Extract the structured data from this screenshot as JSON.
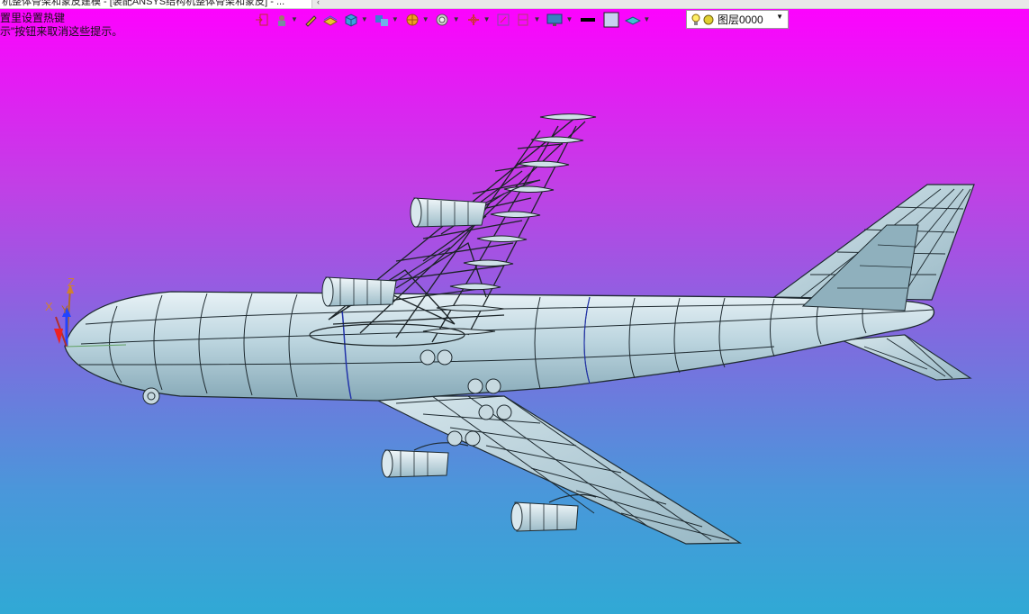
{
  "window": {
    "tab_title": "机整体骨架和蒙皮建模 - [装配ANSYS结构机整体骨架和蒙皮] - ...",
    "tab_scroll": "‹"
  },
  "hint": {
    "line1": "置里设置热键",
    "line2": "示\"按钮来取消这些提示。"
  },
  "toolbar": {
    "items": [
      {
        "name": "insert",
        "icon": "insert-icon"
      },
      {
        "name": "part-nav",
        "icon": "part-navigator-icon"
      },
      {
        "name": "sketch",
        "icon": "pencil-icon"
      },
      {
        "name": "layer-folder",
        "icon": "layer-folder-icon"
      },
      {
        "name": "box",
        "icon": "cube-icon"
      },
      {
        "name": "assembly",
        "icon": "assembly-icon"
      },
      {
        "name": "render",
        "icon": "render-sphere-icon"
      },
      {
        "name": "zoom",
        "icon": "zoom-icon"
      },
      {
        "name": "orient",
        "icon": "orient-icon"
      },
      {
        "name": "fit",
        "icon": "fit-icon"
      },
      {
        "name": "section",
        "icon": "section-icon"
      },
      {
        "name": "display",
        "icon": "display-monitor-icon"
      },
      {
        "name": "line-color",
        "icon": "black-line-icon"
      },
      {
        "name": "face-color",
        "icon": "face-color-icon"
      },
      {
        "name": "layer-visible",
        "icon": "layer-stack-icon"
      }
    ]
  },
  "layer": {
    "value": "图层0000",
    "bulb_color": "#fff066"
  },
  "axes": {
    "x": "X",
    "y": "Y",
    "z": "Z"
  },
  "colors": {
    "background_top": "#ff00ff",
    "background_bottom": "#30a9d5",
    "skin": "#b9d2dc",
    "skin_shade": "#8fb1c0",
    "edge": "#1e2a30"
  }
}
